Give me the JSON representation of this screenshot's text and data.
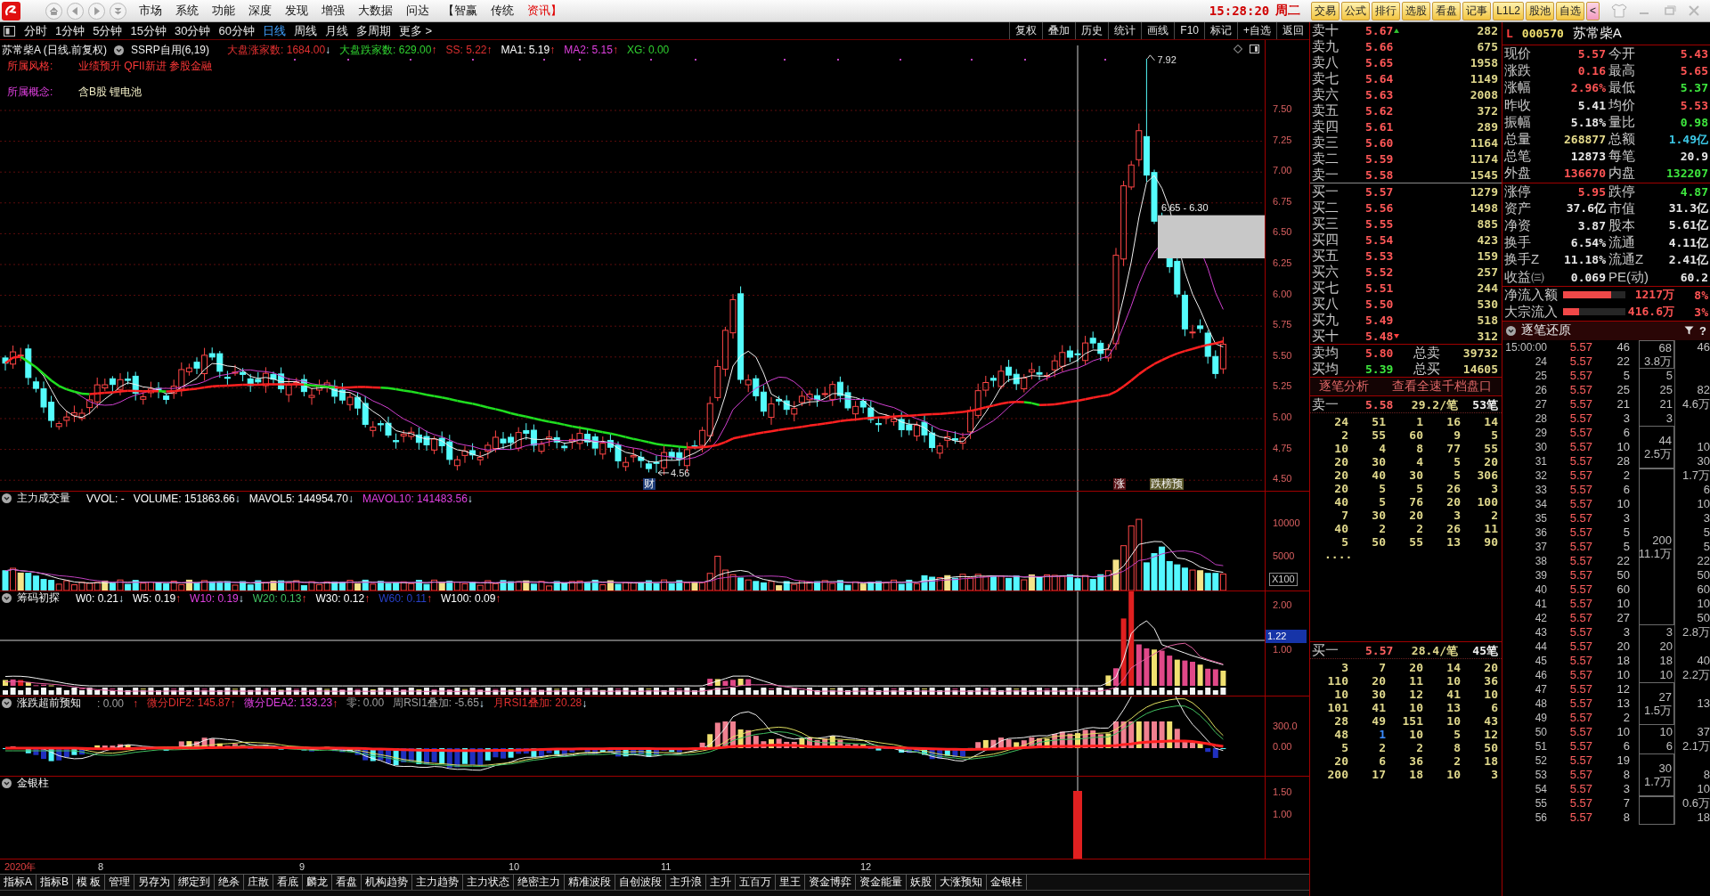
{
  "title_bar": {
    "menu": [
      {
        "label": "市场",
        "highlighted": false
      },
      {
        "label": "系统",
        "highlighted": false
      },
      {
        "label": "功能",
        "highlighted": false
      },
      {
        "label": "深度",
        "highlighted": false
      },
      {
        "label": "发现",
        "highlighted": false
      },
      {
        "label": "增强",
        "highlighted": false
      },
      {
        "label": "大数据",
        "highlighted": false
      },
      {
        "label": "问达",
        "highlighted": false
      },
      {
        "label": "【智赢",
        "highlighted": false
      },
      {
        "label": "传统",
        "highlighted": false
      },
      {
        "label": "资讯】",
        "highlighted": true
      }
    ],
    "clock": "15:28:20",
    "weekday": "周二",
    "quick_buttons": [
      {
        "label": "交易",
        "kind": "menu"
      },
      {
        "label": "公式",
        "kind": "menu"
      },
      {
        "label": "排行",
        "kind": "menu"
      },
      {
        "label": "选股",
        "kind": "menu"
      },
      {
        "label": "看盘",
        "kind": "menu"
      },
      {
        "label": "记事",
        "kind": "menu"
      },
      {
        "label": "L1L2",
        "kind": "menu"
      },
      {
        "label": "股池",
        "kind": "menu"
      },
      {
        "label": "自选",
        "kind": "menu"
      },
      {
        "label": "<",
        "kind": "toggle"
      }
    ]
  },
  "period_tabs": [
    {
      "label": "分时",
      "selected": false
    },
    {
      "label": "1分钟",
      "selected": false
    },
    {
      "label": "5分钟",
      "selected": false
    },
    {
      "label": "15分钟",
      "selected": false
    },
    {
      "label": "30分钟",
      "selected": false
    },
    {
      "label": "60分钟",
      "selected": false
    },
    {
      "label": "日线",
      "selected": true
    },
    {
      "label": "周线",
      "selected": false
    },
    {
      "label": "月线",
      "selected": false
    },
    {
      "label": "多周期",
      "selected": false
    },
    {
      "label": "更多 >",
      "selected": false
    }
  ],
  "chart_tools": [
    "复权",
    "叠加",
    "历史",
    "统计",
    "画线",
    "F10",
    "标记",
    "+自选",
    "返回"
  ],
  "main_chart": {
    "title": "苏常柴A (日线.前复权)",
    "formula": "SSRP自用(6,19)",
    "readouts": [
      {
        "text": "大盘涨家数: 1684.00",
        "arrow": "↓",
        "rising": false,
        "color": "#e03030"
      },
      {
        "text": "大盘跌家数: 629.00",
        "arrow": "↑",
        "rising": true,
        "color": "#30d030"
      },
      {
        "text": "SS: 5.22",
        "arrow": "↑",
        "rising": true,
        "color": "#e03030"
      },
      {
        "text": "MA1: 5.19",
        "arrow": "↑",
        "rising": true,
        "color": "#ffffff"
      },
      {
        "text": "MA2: 5.15",
        "arrow": "↑",
        "rising": true,
        "color": "#e040e0"
      },
      {
        "text": "XG: 0.00",
        "color": "#30d030"
      }
    ],
    "style_label": "所属风格:",
    "style_tags": "业绩预升 QFII新进 参股金融",
    "concept_label": "所属概念:",
    "concepts": "含B股 锂电池",
    "price_ticks": [
      "7.50",
      "7.25",
      "7.00",
      "6.75",
      "6.50",
      "6.25",
      "6.00",
      "5.75",
      "5.50",
      "5.25",
      "5.00",
      "4.75",
      "4.50"
    ],
    "high_label": "7.92",
    "low_label": "4.56",
    "zone_label": "6.65 - 6.30",
    "markers": [
      {
        "label": "财",
        "color": "#1e3c78"
      },
      {
        "label": "涨",
        "color": "#5a1418"
      },
      {
        "label": "跌榜预",
        "color": "#5e5a2c"
      }
    ]
  },
  "indicator_panels": [
    {
      "kind": "volume",
      "name": "主力成交量",
      "readouts": [
        {
          "text": "VVOL: -",
          "color": "#ffffff"
        },
        {
          "text": "VOLUME: 151863.66",
          "arrow": "↓",
          "rising": false,
          "color": "#ffffff"
        },
        {
          "text": "MAVOL5: 144954.70",
          "arrow": "↓",
          "rising": false,
          "color": "#ffffff"
        },
        {
          "text": "MAVOL10: 141483.56",
          "arrow": "↓",
          "rising": false,
          "color": "#e040e0"
        }
      ],
      "axis": [
        "10000",
        "5000"
      ],
      "axis_badge": "X100"
    },
    {
      "kind": "chips",
      "name": "筹码初探",
      "readouts": [
        {
          "text": "W0: 0.21",
          "arrow": "↓",
          "rising": false,
          "color": "#ffffff"
        },
        {
          "text": "W5: 0.19",
          "arrow": "↑",
          "rising": true,
          "color": "#ffffff"
        },
        {
          "text": "W10: 0.19",
          "arrow": "↓",
          "rising": false,
          "color": "#e040e0"
        },
        {
          "text": "W20: 0.13",
          "arrow": "↑",
          "rising": true,
          "color": "#40c060"
        },
        {
          "text": "W30: 0.12",
          "arrow": "↑",
          "rising": true,
          "color": "#ffffff"
        },
        {
          "text": "W60: 0.11",
          "arrow": "↑",
          "rising": true,
          "color": "#2840c8"
        },
        {
          "text": "W100: 0.09",
          "arrow": "↑",
          "rising": true,
          "color": "#ffffff"
        }
      ],
      "axis": [
        "2.00",
        "1.00"
      ],
      "cursor_value": "1.22"
    },
    {
      "kind": "oscillator",
      "name": "涨跌超前预知",
      "readouts": [
        {
          "text": ": 0.00",
          "color": "#a0a0a0"
        },
        {
          "arrow": "↑",
          "rising": true
        },
        {
          "text": "微分DIF2: 145.87",
          "arrow": "↑",
          "rising": true,
          "color": "#e03030"
        },
        {
          "text": "微分DEA2: 133.23",
          "arrow": "↑",
          "rising": true,
          "color": "#e040e0"
        },
        {
          "text": "零: 0.00",
          "color": "#a0a0a0"
        },
        {
          "text": "周RSI1叠加: -5.65",
          "arrow": "↓",
          "rising": false,
          "color": "#a0a0a0"
        },
        {
          "text": "月RSI1叠加: 20.28",
          "arrow": "↓",
          "rising": false,
          "color": "#e03030"
        }
      ],
      "axis": [
        "300.0",
        "0.00"
      ]
    },
    {
      "kind": "columns",
      "name": "金银柱",
      "axis": [
        "1.50",
        "1.00"
      ]
    }
  ],
  "date_axis": [
    {
      "label": "2020年",
      "kind": "year"
    },
    {
      "label": "8",
      "kind": "month"
    },
    {
      "label": "9",
      "kind": "month"
    },
    {
      "label": "10",
      "kind": "month"
    },
    {
      "label": "11",
      "kind": "month"
    },
    {
      "label": "12",
      "kind": "month"
    }
  ],
  "bottom_tabs": [
    "指标A",
    "指标B",
    "模 板",
    "管理",
    "另存为",
    "绑定到",
    "绝杀",
    "庄散",
    "看底",
    "麟龙",
    "看盘",
    "机构趋势",
    "主力趋势",
    "主力状态",
    "绝密主力",
    "精准波段",
    "自创波段",
    "主升浪",
    "主升",
    "五百万",
    "里王",
    "资金博弈",
    "资金能量",
    "妖股",
    "大涨预知",
    "金银柱"
  ],
  "order_book": {
    "asks": [
      {
        "label": "卖十",
        "price": "5.67",
        "volume": "282"
      },
      {
        "label": "卖九",
        "price": "5.66",
        "volume": "675"
      },
      {
        "label": "卖八",
        "price": "5.65",
        "volume": "1958"
      },
      {
        "label": "卖七",
        "price": "5.64",
        "volume": "1149"
      },
      {
        "label": "卖六",
        "price": "5.63",
        "volume": "2008"
      },
      {
        "label": "卖五",
        "price": "5.62",
        "volume": "372"
      },
      {
        "label": "卖四",
        "price": "5.61",
        "volume": "289"
      },
      {
        "label": "卖三",
        "price": "5.60",
        "volume": "1164"
      },
      {
        "label": "卖二",
        "price": "5.59",
        "volume": "1174"
      },
      {
        "label": "卖一",
        "price": "5.58",
        "volume": "1545"
      }
    ],
    "bids": [
      {
        "label": "买一",
        "price": "5.57",
        "volume": "1279"
      },
      {
        "label": "买二",
        "price": "5.56",
        "volume": "1498"
      },
      {
        "label": "买三",
        "price": "5.55",
        "volume": "885"
      },
      {
        "label": "买四",
        "price": "5.54",
        "volume": "423"
      },
      {
        "label": "买五",
        "price": "5.53",
        "volume": "159"
      },
      {
        "label": "买六",
        "price": "5.52",
        "volume": "257"
      },
      {
        "label": "买七",
        "price": "5.51",
        "volume": "244"
      },
      {
        "label": "买八",
        "price": "5.50",
        "volume": "530"
      },
      {
        "label": "买九",
        "price": "5.49",
        "volume": "518"
      },
      {
        "label": "买十",
        "price": "5.48",
        "volume": "312"
      }
    ],
    "averages": [
      {
        "label": "卖均",
        "price": "5.80",
        "kind": "up",
        "total_label": "总卖",
        "total": "39732"
      },
      {
        "label": "买均",
        "price": "5.39",
        "kind": "down",
        "total_label": "总买",
        "total": "14605"
      }
    ],
    "links": [
      "逐笔分析",
      "查看全速千档盘口"
    ],
    "ask_queue": {
      "label": "卖一",
      "price": "5.58",
      "average": "29.2/笔",
      "count": "53笔",
      "rows": [
        [
          "24",
          "51",
          "1",
          "16",
          "14"
        ],
        [
          "2",
          "55",
          "60",
          "9",
          "5"
        ],
        [
          "10",
          "4",
          "8",
          "77",
          "55"
        ],
        [
          "20",
          "30",
          "4",
          "5",
          "20"
        ],
        [
          "20",
          "40",
          "30",
          "5",
          "306"
        ],
        [
          "20",
          "5",
          "5",
          "26",
          "3"
        ],
        [
          "40",
          "5",
          "76",
          "20",
          "100"
        ],
        [
          "7",
          "30",
          "20",
          "3",
          "2"
        ],
        [
          "40",
          "2",
          "2",
          "26",
          "11"
        ],
        [
          "5",
          "50",
          "55",
          "13",
          "90"
        ]
      ],
      "more": "...."
    },
    "bid_queue": {
      "label": "买一",
      "price": "5.57",
      "average": "28.4/笔",
      "count": "45笔",
      "rows": [
        [
          "3",
          "7",
          "20",
          "14",
          "20"
        ],
        [
          "110",
          "20",
          "11",
          "10",
          "36"
        ],
        [
          "10",
          "30",
          "12",
          "41",
          "10"
        ],
        [
          "101",
          "41",
          "10",
          "13",
          "6"
        ],
        [
          "28",
          "49",
          "151",
          "10",
          "43"
        ],
        [
          "48",
          {
            "text": "1",
            "highlighted": true
          },
          "10",
          "5",
          "12"
        ],
        [
          "5",
          "2",
          "2",
          "8",
          "50"
        ],
        [
          "20",
          "6",
          "36",
          "2",
          "18"
        ],
        [
          "200",
          "17",
          "18",
          "10",
          "3"
        ]
      ]
    }
  },
  "quote": {
    "market": "L",
    "code": "000570",
    "name": "苏常柴A",
    "sections": [
      [
        [
          {
            "label": "现价",
            "value": "5.57",
            "kind": "up"
          },
          {
            "label": "今开",
            "value": "5.43",
            "kind": "up"
          }
        ],
        [
          {
            "label": "涨跌",
            "value": "0.16",
            "kind": "up"
          },
          {
            "label": "最高",
            "value": "5.65",
            "kind": "up"
          }
        ],
        [
          {
            "label": "涨幅",
            "value": "2.96%",
            "kind": "up"
          },
          {
            "label": "最低",
            "value": "5.37",
            "kind": "down"
          }
        ],
        [
          {
            "label": "昨收",
            "value": "5.41",
            "kind": "neutral"
          },
          {
            "label": "均价",
            "value": "5.53",
            "kind": "up"
          }
        ],
        [
          {
            "label": "振幅",
            "value": "5.18%",
            "kind": "neutral"
          },
          {
            "label": "量比",
            "value": "0.98",
            "kind": "down"
          }
        ],
        [
          {
            "label": "总量",
            "value": "268877",
            "kind": "volume"
          },
          {
            "label": "总额",
            "value": "1.49亿",
            "kind": "amount"
          }
        ],
        [
          {
            "label": "总笔",
            "value": "12873",
            "kind": "neutral"
          },
          {
            "label": "每笔",
            "value": "20.9",
            "kind": "neutral"
          }
        ],
        [
          {
            "label": "外盘",
            "value": "136670",
            "kind": "up"
          },
          {
            "label": "内盘",
            "value": "132207",
            "kind": "down"
          }
        ]
      ],
      [
        [
          {
            "label": "涨停",
            "value": "5.95",
            "kind": "up"
          },
          {
            "label": "跌停",
            "value": "4.87",
            "kind": "down"
          }
        ],
        [
          {
            "label": "资产",
            "value": "37.6亿",
            "kind": "neutral"
          },
          {
            "label": "市值",
            "value": "31.3亿",
            "kind": "neutral"
          }
        ],
        [
          {
            "label": "净资",
            "value": "3.87",
            "kind": "neutral"
          },
          {
            "label": "股本",
            "value": "5.61亿",
            "kind": "neutral"
          }
        ],
        [
          {
            "label": "换手",
            "value": "6.54%",
            "kind": "neutral"
          },
          {
            "label": "流通",
            "value": "4.11亿",
            "kind": "neutral"
          }
        ],
        [
          {
            "label": "换手Z",
            "value": "11.18%",
            "kind": "neutral"
          },
          {
            "label": "流通Z",
            "value": "2.41亿",
            "kind": "neutral"
          }
        ],
        [
          {
            "label": "收益㈢",
            "value": "0.069",
            "kind": "neutral"
          },
          {
            "label": "PE(动)",
            "value": "60.2",
            "kind": "neutral"
          }
        ]
      ]
    ],
    "flows": [
      {
        "label": "净流入额",
        "level": 0.77,
        "value": "1217万",
        "percent": "8%"
      },
      {
        "label": "大宗流入",
        "level": 0.25,
        "value": "416.6万",
        "percent": "3%"
      }
    ]
  },
  "tick_list": {
    "title": "逐笔还原",
    "help": "?",
    "groups": [
      {
        "total": "68",
        "amount": "3.8万",
        "ticks": [
          {
            "time": "15:00:00",
            "price": "5.57",
            "volume": "46",
            "column_5": "46"
          },
          {
            "time": "24",
            "price": "5.57",
            "volume": "22"
          }
        ]
      },
      {
        "total": "5",
        "ticks": [
          {
            "time": "25",
            "price": "5.57",
            "volume": "5"
          }
        ]
      },
      {
        "total": "25",
        "ticks": [
          {
            "time": "26",
            "price": "5.57",
            "volume": "25",
            "column_5": "82"
          }
        ]
      },
      {
        "total": "21",
        "ticks": [
          {
            "time": "27",
            "price": "5.57",
            "volume": "21",
            "column_5": "4.6万"
          }
        ]
      },
      {
        "total": "3",
        "ticks": [
          {
            "time": "28",
            "price": "5.57",
            "volume": "3"
          }
        ]
      },
      {
        "total": "44",
        "amount": "2.5万",
        "ticks": [
          {
            "time": "29",
            "price": "5.57",
            "volume": "6"
          },
          {
            "time": "30",
            "price": "5.57",
            "volume": "10",
            "column_5": "10"
          },
          {
            "time": "31",
            "price": "5.57",
            "volume": "28",
            "column_5": "30"
          }
        ]
      },
      {
        "total": "200",
        "amount": "11.1万",
        "ticks": [
          {
            "time": "32",
            "price": "5.57",
            "volume": "2",
            "column_5": "1.7万"
          },
          {
            "time": "33",
            "price": "5.57",
            "volume": "6",
            "column_5": "6"
          },
          {
            "time": "34",
            "price": "5.57",
            "volume": "10",
            "column_5": "10"
          },
          {
            "time": "35",
            "price": "5.57",
            "volume": "3",
            "column_5": "3"
          },
          {
            "time": "36",
            "price": "5.57",
            "volume": "5",
            "column_5": "5"
          },
          {
            "time": "37",
            "price": "5.57",
            "volume": "5",
            "column_5": "5"
          },
          {
            "time": "38",
            "price": "5.57",
            "volume": "22",
            "column_5": "22"
          },
          {
            "time": "39",
            "price": "5.57",
            "volume": "50",
            "column_5": "50"
          },
          {
            "time": "40",
            "price": "5.57",
            "volume": "60",
            "column_5": "60"
          },
          {
            "time": "41",
            "price": "5.57",
            "volume": "10",
            "column_5": "10"
          },
          {
            "time": "42",
            "price": "5.57",
            "volume": "27",
            "column_5": "50"
          }
        ]
      },
      {
        "total": "3",
        "ticks": [
          {
            "time": "43",
            "price": "5.57",
            "volume": "3",
            "column_5": "2.8万"
          }
        ]
      },
      {
        "total": "20",
        "ticks": [
          {
            "time": "44",
            "price": "5.57",
            "volume": "20"
          }
        ]
      },
      {
        "total": "18",
        "ticks": [
          {
            "time": "45",
            "price": "5.57",
            "volume": "18",
            "column_5": "40"
          }
        ]
      },
      {
        "total": "10",
        "ticks": [
          {
            "time": "46",
            "price": "5.57",
            "volume": "10",
            "column_5": "2.2万"
          }
        ]
      },
      {
        "total": "27",
        "amount": "1.5万",
        "ticks": [
          {
            "time": "47",
            "price": "5.57",
            "volume": "12"
          },
          {
            "time": "48",
            "price": "5.57",
            "volume": "13",
            "column_5": "13"
          },
          {
            "time": "49",
            "price": "5.57",
            "volume": "2"
          }
        ]
      },
      {
        "total": "10",
        "ticks": [
          {
            "time": "50",
            "price": "5.57",
            "volume": "10",
            "column_5": "37"
          }
        ]
      },
      {
        "total": "6",
        "ticks": [
          {
            "time": "51",
            "price": "5.57",
            "volume": "6",
            "column_5": "2.1万"
          }
        ]
      },
      {
        "total": "30",
        "amount": "1.7万",
        "ticks": [
          {
            "time": "52",
            "price": "5.57",
            "volume": "19"
          },
          {
            "time": "53",
            "price": "5.57",
            "volume": "8",
            "column_5": "8"
          },
          {
            "time": "54",
            "price": "5.57",
            "volume": "3",
            "column_5": "10"
          }
        ]
      },
      {
        "ticks": [
          {
            "time": "55",
            "price": "5.57",
            "volume": "7",
            "column_5": "0.6万"
          },
          {
            "time": "56",
            "price": "5.57",
            "volume": "8",
            "column_5": "18"
          }
        ]
      }
    ]
  }
}
